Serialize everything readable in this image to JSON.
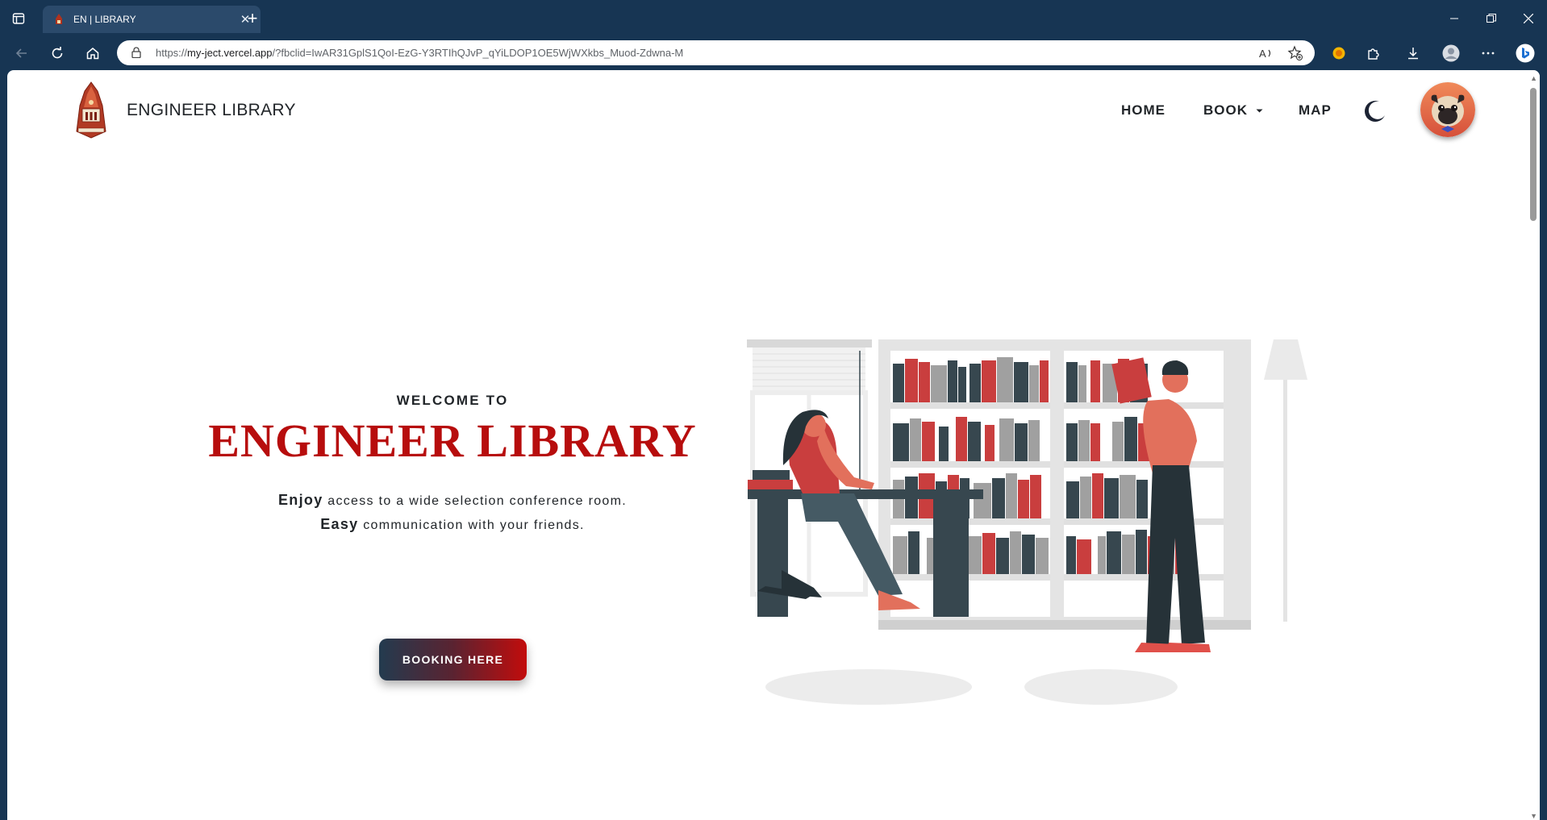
{
  "browser": {
    "tab_title": "EN | LIBRARY",
    "url_prefix": "https://",
    "url_host": "my-ject.vercel.app",
    "url_rest": "/?fbclid=IwAR31GplS1QoI-EzG-Y3RTIhQJvP_qYiLDOP1OE5WjWXkbs_Muod-Zdwna-M"
  },
  "navbar": {
    "brand": "ENGINEER LIBRARY",
    "home": "HOME",
    "book": "BOOK",
    "map": "MAP"
  },
  "hero": {
    "welcome": "WELCOME TO",
    "title": "ENGINEER LIBRARY",
    "line1_first": "Enjoy",
    "line1_rest": " access to a wide selection conference room.",
    "line2_first": "Easy",
    "line2_rest": " communication with your friends.",
    "button": "BOOKING HERE"
  },
  "colors": {
    "accent_red": "#b70d0d",
    "dark": "#37474f",
    "chrome": "#173553"
  }
}
